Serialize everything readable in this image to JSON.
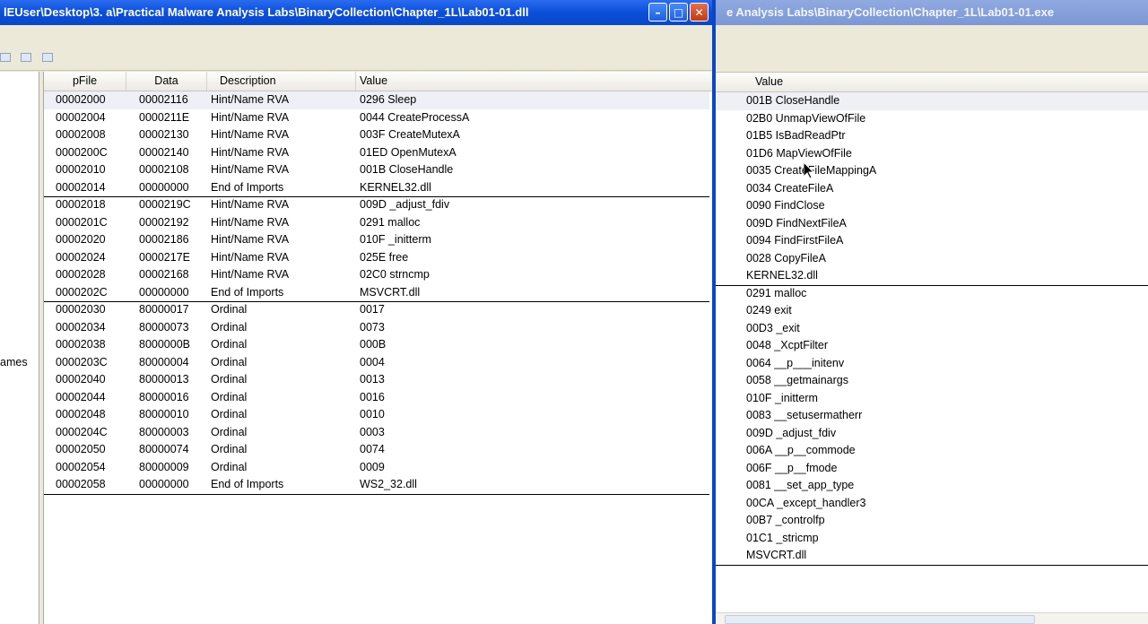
{
  "left_window": {
    "title": "lEUser\\Desktop\\3. a\\Practical Malware Analysis Labs\\BinaryCollection\\Chapter_1L\\Lab01-01.dll",
    "buttons": {
      "minimize": "–",
      "maximize": "□",
      "close": "✕"
    },
    "tree_partial_label": "ames",
    "columns": {
      "pfile": "pFile",
      "data": "Data",
      "description": "Description",
      "value": "Value"
    },
    "rows": [
      {
        "pfile": "00002000",
        "data": "00002116",
        "desc": "Hint/Name RVA",
        "value": "0296  Sleep"
      },
      {
        "pfile": "00002004",
        "data": "0000211E",
        "desc": "Hint/Name RVA",
        "value": "0044  CreateProcessA"
      },
      {
        "pfile": "00002008",
        "data": "00002130",
        "desc": "Hint/Name RVA",
        "value": "003F  CreateMutexA"
      },
      {
        "pfile": "0000200C",
        "data": "00002140",
        "desc": "Hint/Name RVA",
        "value": "01ED  OpenMutexA"
      },
      {
        "pfile": "00002010",
        "data": "00002108",
        "desc": "Hint/Name RVA",
        "value": "001B  CloseHandle"
      },
      {
        "pfile": "00002014",
        "data": "00000000",
        "desc": "End of Imports",
        "value": "KERNEL32.dll"
      },
      {
        "pfile": "00002018",
        "data": "0000219C",
        "desc": "Hint/Name RVA",
        "value": "009D  _adjust_fdiv"
      },
      {
        "pfile": "0000201C",
        "data": "00002192",
        "desc": "Hint/Name RVA",
        "value": "0291  malloc"
      },
      {
        "pfile": "00002020",
        "data": "00002186",
        "desc": "Hint/Name RVA",
        "value": "010F  _initterm"
      },
      {
        "pfile": "00002024",
        "data": "0000217E",
        "desc": "Hint/Name RVA",
        "value": "025E  free"
      },
      {
        "pfile": "00002028",
        "data": "00002168",
        "desc": "Hint/Name RVA",
        "value": "02C0  strncmp"
      },
      {
        "pfile": "0000202C",
        "data": "00000000",
        "desc": "End of Imports",
        "value": "MSVCRT.dll"
      },
      {
        "pfile": "00002030",
        "data": "80000017",
        "desc": "Ordinal",
        "value": "0017"
      },
      {
        "pfile": "00002034",
        "data": "80000073",
        "desc": "Ordinal",
        "value": "0073"
      },
      {
        "pfile": "00002038",
        "data": "8000000B",
        "desc": "Ordinal",
        "value": "000B"
      },
      {
        "pfile": "0000203C",
        "data": "80000004",
        "desc": "Ordinal",
        "value": "0004"
      },
      {
        "pfile": "00002040",
        "data": "80000013",
        "desc": "Ordinal",
        "value": "0013"
      },
      {
        "pfile": "00002044",
        "data": "80000016",
        "desc": "Ordinal",
        "value": "0016"
      },
      {
        "pfile": "00002048",
        "data": "80000010",
        "desc": "Ordinal",
        "value": "0010"
      },
      {
        "pfile": "0000204C",
        "data": "80000003",
        "desc": "Ordinal",
        "value": "0003"
      },
      {
        "pfile": "00002050",
        "data": "80000074",
        "desc": "Ordinal",
        "value": "0074"
      },
      {
        "pfile": "00002054",
        "data": "80000009",
        "desc": "Ordinal",
        "value": "0009"
      },
      {
        "pfile": "00002058",
        "data": "00000000",
        "desc": "End of Imports",
        "value": "WS2_32.dll"
      }
    ]
  },
  "right_window": {
    "title": "e Analysis Labs\\BinaryCollection\\Chapter_1L\\Lab01-01.exe",
    "column_value": "Value",
    "rows": [
      "001B  CloseHandle",
      "02B0  UnmapViewOfFile",
      "01B5  IsBadReadPtr",
      "01D6  MapViewOfFile",
      "0035  CreateFileMappingA",
      "0034  CreateFileA",
      "0090  FindClose",
      "009D  FindNextFileA",
      "0094  FindFirstFileA",
      "0028  CopyFileA",
      "KERNEL32.dll",
      "0291  malloc",
      "0249  exit",
      "00D3  _exit",
      "0048  _XcptFilter",
      "0064  __p___initenv",
      "0058  __getmainargs",
      "010F  _initterm",
      "0083  __setusermatherr",
      "009D  _adjust_fdiv",
      "006A  __p__commode",
      "006F  __p__fmode",
      "0081  __set_app_type",
      "00CA  _except_handler3",
      "00B7  _controlfp",
      "01C1  _stricmp",
      "MSVCRT.dll"
    ]
  }
}
